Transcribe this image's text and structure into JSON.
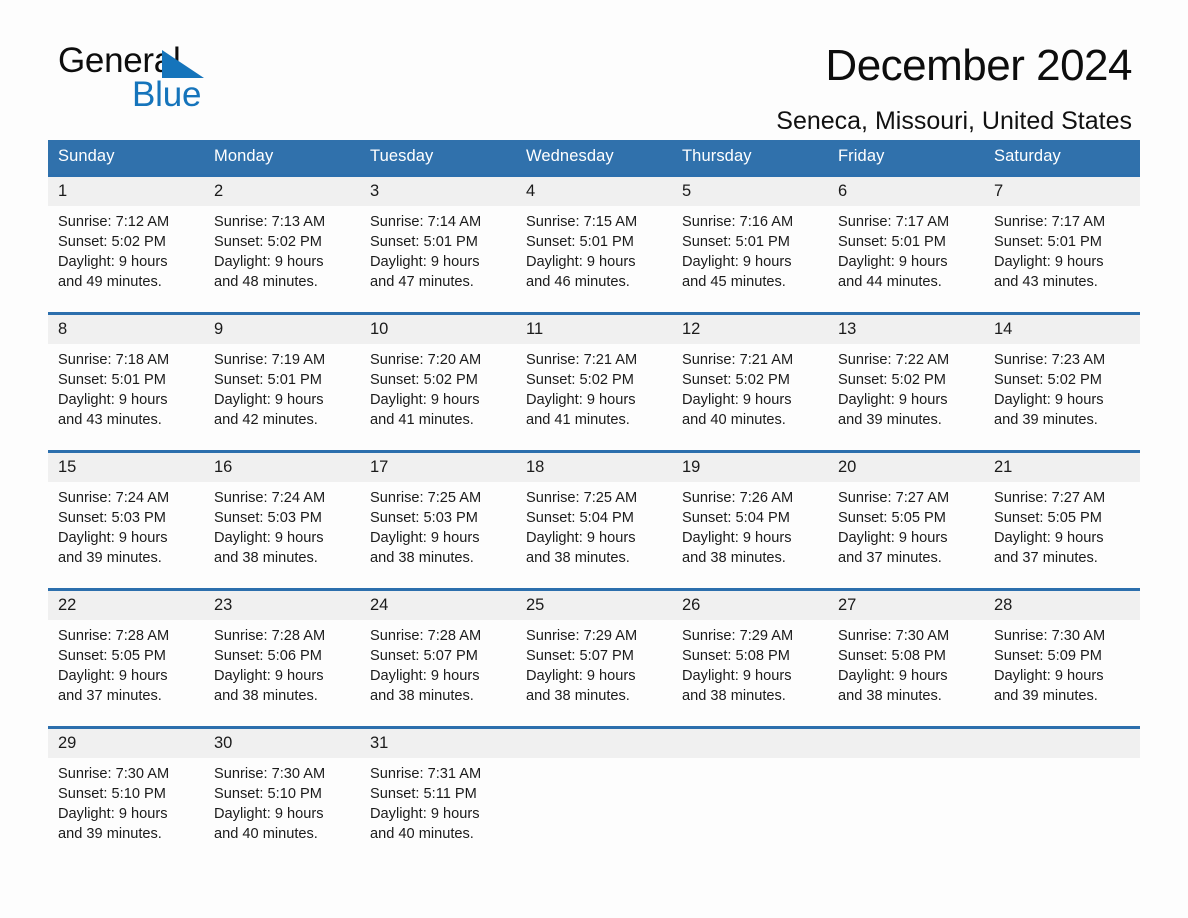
{
  "brand": {
    "line1": "General",
    "line2": "Blue",
    "logo_icon": "triangle-icon",
    "accent_color": "#1574bb"
  },
  "header": {
    "month_title": "December 2024",
    "location": "Seneca, Missouri, United States"
  },
  "colors": {
    "header_blue": "#3071ac",
    "row_rule_blue": "#2c6fad",
    "daynum_band": "#f0f0f0",
    "page_background": "#fdfdfd",
    "text": "#1b1b1b"
  },
  "calendar": {
    "weekday_headers": [
      "Sunday",
      "Monday",
      "Tuesday",
      "Wednesday",
      "Thursday",
      "Friday",
      "Saturday"
    ],
    "weeks": [
      [
        {
          "day": "1",
          "sunrise": "Sunrise: 7:12 AM",
          "sunset": "Sunset: 5:02 PM",
          "daylight": "Daylight: 9 hours and 49 minutes."
        },
        {
          "day": "2",
          "sunrise": "Sunrise: 7:13 AM",
          "sunset": "Sunset: 5:02 PM",
          "daylight": "Daylight: 9 hours and 48 minutes."
        },
        {
          "day": "3",
          "sunrise": "Sunrise: 7:14 AM",
          "sunset": "Sunset: 5:01 PM",
          "daylight": "Daylight: 9 hours and 47 minutes."
        },
        {
          "day": "4",
          "sunrise": "Sunrise: 7:15 AM",
          "sunset": "Sunset: 5:01 PM",
          "daylight": "Daylight: 9 hours and 46 minutes."
        },
        {
          "day": "5",
          "sunrise": "Sunrise: 7:16 AM",
          "sunset": "Sunset: 5:01 PM",
          "daylight": "Daylight: 9 hours and 45 minutes."
        },
        {
          "day": "6",
          "sunrise": "Sunrise: 7:17 AM",
          "sunset": "Sunset: 5:01 PM",
          "daylight": "Daylight: 9 hours and 44 minutes."
        },
        {
          "day": "7",
          "sunrise": "Sunrise: 7:17 AM",
          "sunset": "Sunset: 5:01 PM",
          "daylight": "Daylight: 9 hours and 43 minutes."
        }
      ],
      [
        {
          "day": "8",
          "sunrise": "Sunrise: 7:18 AM",
          "sunset": "Sunset: 5:01 PM",
          "daylight": "Daylight: 9 hours and 43 minutes."
        },
        {
          "day": "9",
          "sunrise": "Sunrise: 7:19 AM",
          "sunset": "Sunset: 5:01 PM",
          "daylight": "Daylight: 9 hours and 42 minutes."
        },
        {
          "day": "10",
          "sunrise": "Sunrise: 7:20 AM",
          "sunset": "Sunset: 5:02 PM",
          "daylight": "Daylight: 9 hours and 41 minutes."
        },
        {
          "day": "11",
          "sunrise": "Sunrise: 7:21 AM",
          "sunset": "Sunset: 5:02 PM",
          "daylight": "Daylight: 9 hours and 41 minutes."
        },
        {
          "day": "12",
          "sunrise": "Sunrise: 7:21 AM",
          "sunset": "Sunset: 5:02 PM",
          "daylight": "Daylight: 9 hours and 40 minutes."
        },
        {
          "day": "13",
          "sunrise": "Sunrise: 7:22 AM",
          "sunset": "Sunset: 5:02 PM",
          "daylight": "Daylight: 9 hours and 39 minutes."
        },
        {
          "day": "14",
          "sunrise": "Sunrise: 7:23 AM",
          "sunset": "Sunset: 5:02 PM",
          "daylight": "Daylight: 9 hours and 39 minutes."
        }
      ],
      [
        {
          "day": "15",
          "sunrise": "Sunrise: 7:24 AM",
          "sunset": "Sunset: 5:03 PM",
          "daylight": "Daylight: 9 hours and 39 minutes."
        },
        {
          "day": "16",
          "sunrise": "Sunrise: 7:24 AM",
          "sunset": "Sunset: 5:03 PM",
          "daylight": "Daylight: 9 hours and 38 minutes."
        },
        {
          "day": "17",
          "sunrise": "Sunrise: 7:25 AM",
          "sunset": "Sunset: 5:03 PM",
          "daylight": "Daylight: 9 hours and 38 minutes."
        },
        {
          "day": "18",
          "sunrise": "Sunrise: 7:25 AM",
          "sunset": "Sunset: 5:04 PM",
          "daylight": "Daylight: 9 hours and 38 minutes."
        },
        {
          "day": "19",
          "sunrise": "Sunrise: 7:26 AM",
          "sunset": "Sunset: 5:04 PM",
          "daylight": "Daylight: 9 hours and 38 minutes."
        },
        {
          "day": "20",
          "sunrise": "Sunrise: 7:27 AM",
          "sunset": "Sunset: 5:05 PM",
          "daylight": "Daylight: 9 hours and 37 minutes."
        },
        {
          "day": "21",
          "sunrise": "Sunrise: 7:27 AM",
          "sunset": "Sunset: 5:05 PM",
          "daylight": "Daylight: 9 hours and 37 minutes."
        }
      ],
      [
        {
          "day": "22",
          "sunrise": "Sunrise: 7:28 AM",
          "sunset": "Sunset: 5:05 PM",
          "daylight": "Daylight: 9 hours and 37 minutes."
        },
        {
          "day": "23",
          "sunrise": "Sunrise: 7:28 AM",
          "sunset": "Sunset: 5:06 PM",
          "daylight": "Daylight: 9 hours and 38 minutes."
        },
        {
          "day": "24",
          "sunrise": "Sunrise: 7:28 AM",
          "sunset": "Sunset: 5:07 PM",
          "daylight": "Daylight: 9 hours and 38 minutes."
        },
        {
          "day": "25",
          "sunrise": "Sunrise: 7:29 AM",
          "sunset": "Sunset: 5:07 PM",
          "daylight": "Daylight: 9 hours and 38 minutes."
        },
        {
          "day": "26",
          "sunrise": "Sunrise: 7:29 AM",
          "sunset": "Sunset: 5:08 PM",
          "daylight": "Daylight: 9 hours and 38 minutes."
        },
        {
          "day": "27",
          "sunrise": "Sunrise: 7:30 AM",
          "sunset": "Sunset: 5:08 PM",
          "daylight": "Daylight: 9 hours and 38 minutes."
        },
        {
          "day": "28",
          "sunrise": "Sunrise: 7:30 AM",
          "sunset": "Sunset: 5:09 PM",
          "daylight": "Daylight: 9 hours and 39 minutes."
        }
      ],
      [
        {
          "day": "29",
          "sunrise": "Sunrise: 7:30 AM",
          "sunset": "Sunset: 5:10 PM",
          "daylight": "Daylight: 9 hours and 39 minutes."
        },
        {
          "day": "30",
          "sunrise": "Sunrise: 7:30 AM",
          "sunset": "Sunset: 5:10 PM",
          "daylight": "Daylight: 9 hours and 40 minutes."
        },
        {
          "day": "31",
          "sunrise": "Sunrise: 7:31 AM",
          "sunset": "Sunset: 5:11 PM",
          "daylight": "Daylight: 9 hours and 40 minutes."
        },
        {
          "day": "",
          "sunrise": "",
          "sunset": "",
          "daylight": ""
        },
        {
          "day": "",
          "sunrise": "",
          "sunset": "",
          "daylight": ""
        },
        {
          "day": "",
          "sunrise": "",
          "sunset": "",
          "daylight": ""
        },
        {
          "day": "",
          "sunrise": "",
          "sunset": "",
          "daylight": ""
        }
      ]
    ]
  }
}
